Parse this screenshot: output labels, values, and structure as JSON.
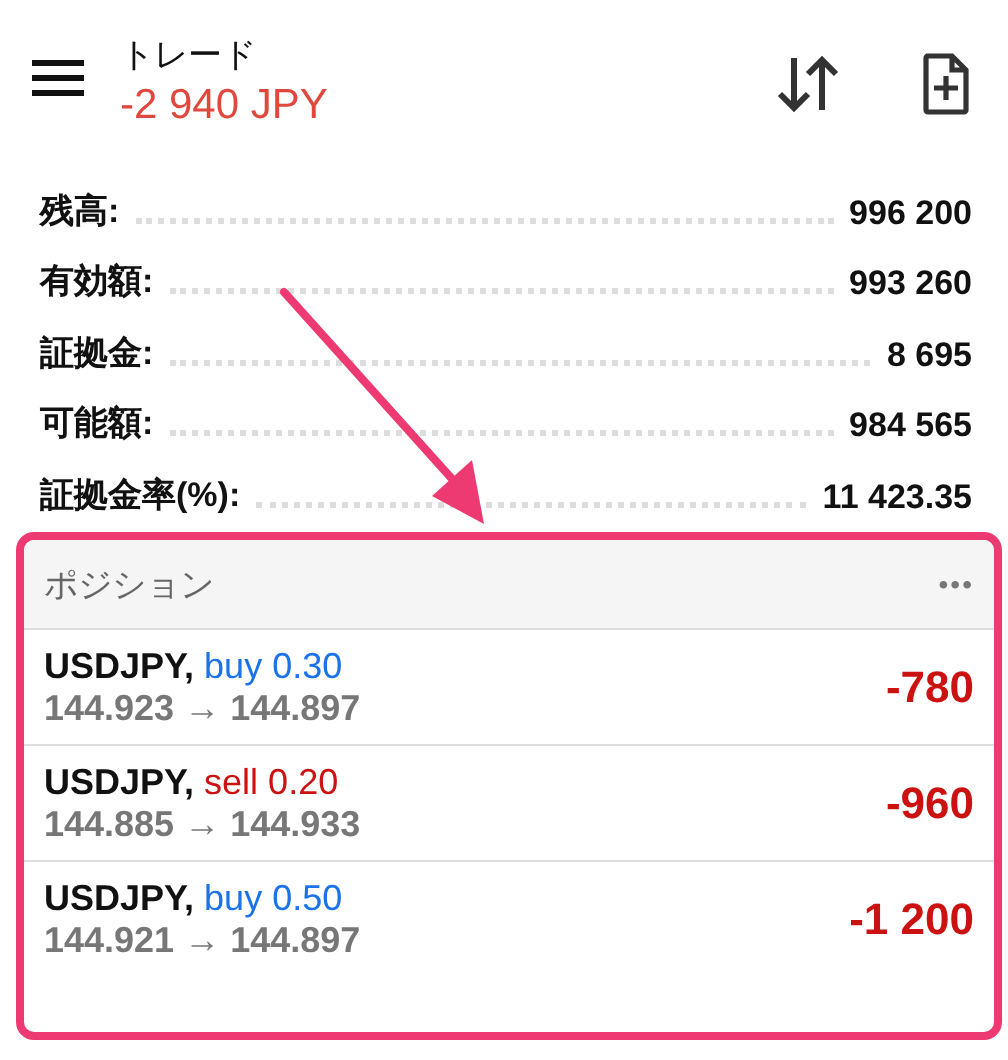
{
  "header": {
    "title": "トレード",
    "profit": "-2 940 JPY"
  },
  "summary": [
    {
      "label": "残高:",
      "value": "996 200"
    },
    {
      "label": "有効額:",
      "value": "993 260"
    },
    {
      "label": "証拠金:",
      "value": "8 695"
    },
    {
      "label": "可能額:",
      "value": "984 565"
    },
    {
      "label": "証拠金率(%):",
      "value": "11 423.35"
    }
  ],
  "positions": {
    "title": "ポジション",
    "menu": "•••",
    "rows": [
      {
        "symbol": "USDJPY,",
        "side": "buy 0.30",
        "color": "#1a73e8",
        "prices": "144.923 → 144.897",
        "profit": "-780"
      },
      {
        "symbol": "USDJPY,",
        "side": "sell 0.20",
        "color": "#cc1111",
        "prices": "144.885 → 144.933",
        "profit": "-960"
      },
      {
        "symbol": "USDJPY,",
        "side": "buy 0.50",
        "color": "#1a73e8",
        "prices": "144.921 → 144.897",
        "profit": "-1 200"
      }
    ]
  }
}
